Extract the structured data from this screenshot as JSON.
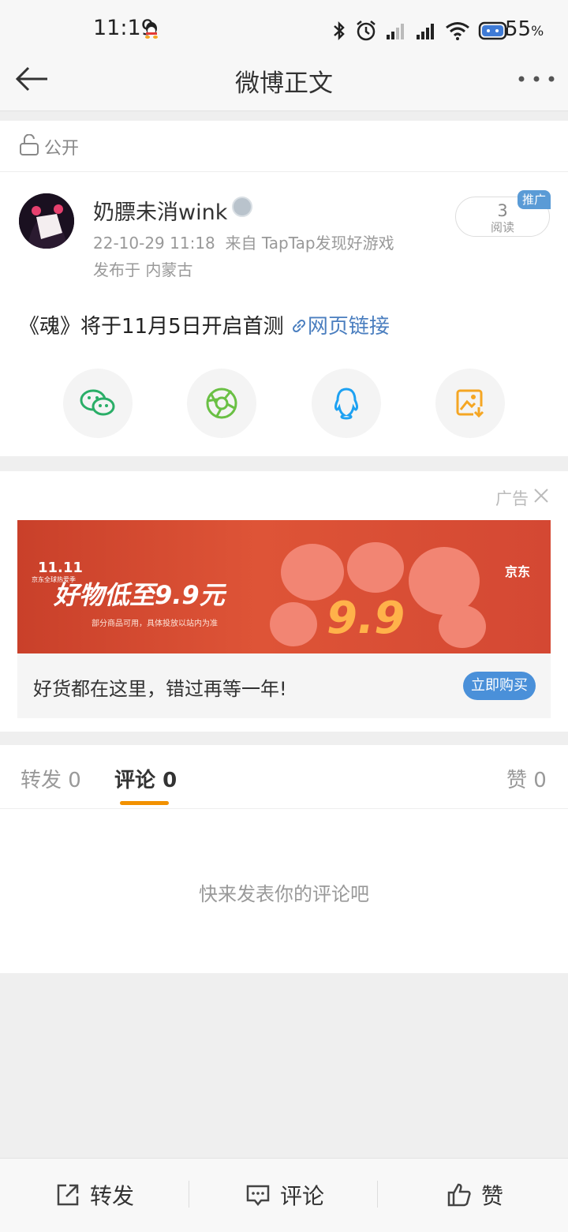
{
  "status_bar": {
    "time": "11:19",
    "battery": "55",
    "battery_unit": "%"
  },
  "nav": {
    "title": "微博正文"
  },
  "visibility": {
    "label": "公开"
  },
  "post": {
    "username": "奶膘未消wink",
    "timestamp": "22-10-29 11:18",
    "source": "来自 TapTap发现好游戏",
    "location": "发布于 内蒙古",
    "read_count": "3",
    "read_label": "阅读",
    "promo_badge": "推广",
    "text": "《魂》将于11月5日开启首测",
    "link_label": "网页链接"
  },
  "share_icons": [
    "wechat-icon",
    "moments-icon",
    "qq-icon",
    "save-image-icon"
  ],
  "ad": {
    "label": "广告",
    "banner_event": "11.11",
    "banner_sub": "京东全球热爱季",
    "banner_headline": "好物低至9.9元",
    "banner_note": "部分商品可用，具体投放以站内为准",
    "banner_price": "9.9",
    "banner_brand": "京东",
    "caption": "好货都在这里，错过再等一年!",
    "buy_label": "立即购买",
    "colors": {
      "banner": "#d44833",
      "button": "#4a90d9"
    }
  },
  "tabs": {
    "repost": {
      "label": "转发",
      "count": "0"
    },
    "comment": {
      "label": "评论",
      "count": "0"
    },
    "like": {
      "label": "赞",
      "count": "0"
    },
    "active": "comment",
    "indicator_color": "#f29100"
  },
  "comments": {
    "empty_text": "快来发表你的评论吧"
  },
  "bottom_bar": {
    "repost": "转发",
    "comment": "评论",
    "like": "赞"
  }
}
